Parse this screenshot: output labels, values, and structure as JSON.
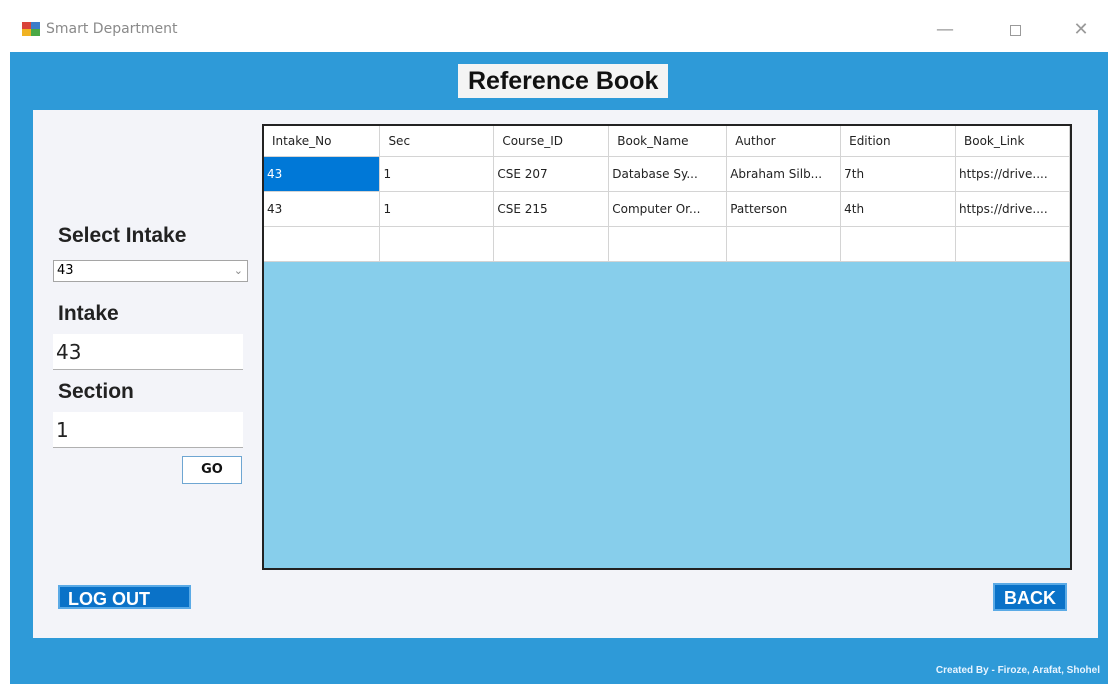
{
  "window": {
    "title": "Smart Department",
    "minimize_glyph": "—",
    "close_glyph": "✕"
  },
  "heading": "Reference Book",
  "sidebar": {
    "select_intake_label": "Select Intake",
    "select_intake_value": "43",
    "intake_label": "Intake",
    "intake_value": "43",
    "section_label": "Section",
    "section_value": "1",
    "go_label": "GO"
  },
  "grid": {
    "columns": [
      "Intake_No",
      "Sec",
      "Course_ID",
      "Book_Name",
      "Author",
      "Edition",
      "Book_Link"
    ],
    "rows": [
      [
        "43",
        "1",
        "CSE 207",
        "Database Sy...",
        "Abraham Silb...",
        "7th",
        "https://drive...."
      ],
      [
        "43",
        "1",
        "CSE 215",
        "Computer Or...",
        "Patterson",
        "4th",
        "https://drive...."
      ],
      [
        "",
        "",
        "",
        "",
        "",
        "",
        ""
      ]
    ],
    "selected_cell": "row0-col0"
  },
  "buttons": {
    "logout": "LOG OUT",
    "back": "BACK"
  },
  "footer": {
    "credit": "Created By - Firoze, Arafat, Shohel"
  },
  "colors": {
    "main_background": "#2e9ad8",
    "grid_background": "#87ceeb",
    "button_blue": "#0a72c8",
    "selection": "#0078d7"
  },
  "icons": {
    "app": "app-icon",
    "dropdown": "chevron-down-icon"
  }
}
